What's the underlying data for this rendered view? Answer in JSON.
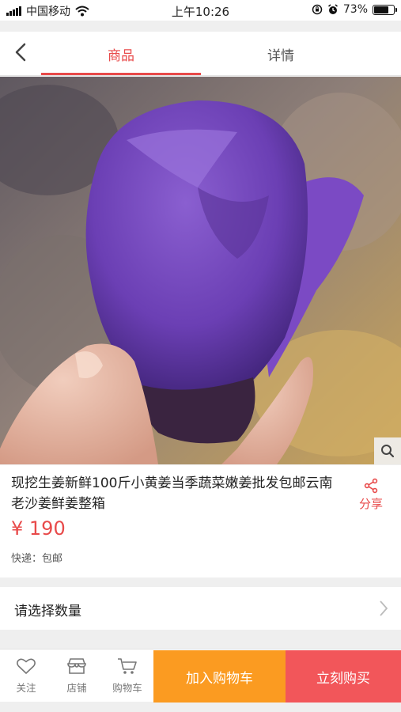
{
  "status_bar": {
    "carrier": "中国移动",
    "time": "上午10:26",
    "battery_text": "73%",
    "battery_level": 0.73
  },
  "nav": {
    "tabs": [
      {
        "label": "商品",
        "active": true
      },
      {
        "label": "详情",
        "active": false
      }
    ]
  },
  "product": {
    "title": "现挖生姜新鲜100斤小黄姜当季蔬菜嫩姜批发包邮云南老沙姜鲜姜整箱",
    "price": "¥ 190",
    "shipping": "快递：包邮",
    "share_label": "分享"
  },
  "quantity": {
    "label": "请选择数量"
  },
  "bottom_bar": {
    "favorite_label": "关注",
    "shop_label": "店铺",
    "cart_label": "购物车",
    "add_to_cart_label": "加入购物车",
    "buy_now_label": "立刻购买"
  },
  "colors": {
    "accent": "#e84a4a",
    "add_to_cart": "#fb9b21",
    "buy_now": "#f2565a"
  },
  "icons": [
    "back-icon",
    "search-icon",
    "share-icon",
    "heart-icon",
    "shop-icon",
    "cart-icon",
    "chevron-right-icon",
    "wifi-icon",
    "lock-rotation-icon",
    "alarm-icon",
    "signal-icon",
    "battery-icon"
  ]
}
